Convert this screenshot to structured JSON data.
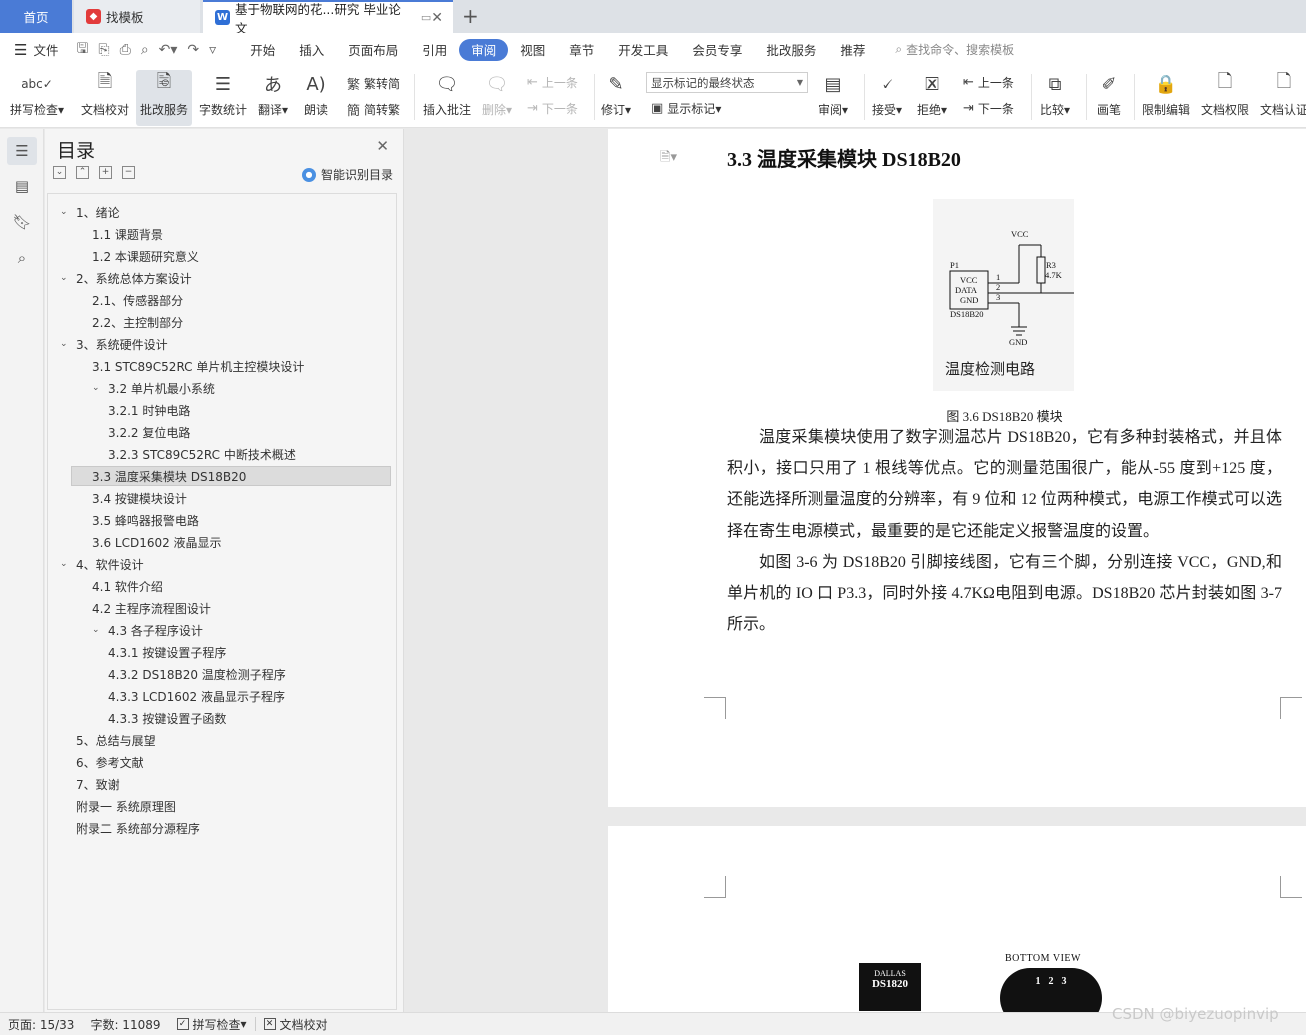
{
  "tabs": {
    "home": "首页",
    "templates": "找模板",
    "document": "基于物联网的花...研究 毕业论文"
  },
  "menubar": {
    "file": "文件",
    "items": [
      "开始",
      "插入",
      "页面布局",
      "引用",
      "审阅",
      "视图",
      "章节",
      "开发工具",
      "会员专享",
      "批改服务",
      "推荐"
    ],
    "active": "审阅",
    "search_placeholder": "查找命令、搜索模板"
  },
  "ribbon": {
    "spell_check": "拼写检查",
    "doc_proof": "文档校对",
    "correction_service": "批改服务",
    "word_count": "字数统计",
    "translate": "翻译",
    "read_aloud": "朗读",
    "simp_to_trad": "繁转简",
    "trad_to_simp": "简转繁",
    "insert_comment": "插入批注",
    "delete": "删除",
    "prev_comment": "上一条",
    "next_comment": "下一条",
    "revise": "修订",
    "markup_state": "显示标记的最终状态",
    "show_markup": "显示标记",
    "review": "审阅",
    "accept": "接受",
    "reject": "拒绝",
    "prev_change": "上一条",
    "next_change": "下一条",
    "compare": "比较",
    "pen": "画笔",
    "restrict_edit": "限制编辑",
    "doc_permission": "文档权限",
    "doc_certify": "文档认证"
  },
  "toc": {
    "title": "目录",
    "smart_recognize": "智能识别目录",
    "items": [
      {
        "label": "1、绪论",
        "level": 1,
        "expanded": true
      },
      {
        "label": "1.1 课题背景",
        "level": 2
      },
      {
        "label": "1.2  本课题研究意义",
        "level": 2
      },
      {
        "label": "2、系统总体方案设计",
        "level": 1,
        "expanded": true
      },
      {
        "label": "2.1、传感器部分",
        "level": 2
      },
      {
        "label": "2.2、主控制部分",
        "level": 2
      },
      {
        "label": "3、系统硬件设计",
        "level": 1,
        "expanded": true
      },
      {
        "label": "3.1 STC89C52RC 单片机主控模块设计",
        "level": 2
      },
      {
        "label": "3.2 单片机最小系统",
        "level": 2,
        "expanded": true
      },
      {
        "label": "3.2.1 时钟电路",
        "level": 3
      },
      {
        "label": "3.2.2 复位电路",
        "level": 3
      },
      {
        "label": "3.2.3 STC89C52RC 中断技术概述",
        "level": 3
      },
      {
        "label": "3.3  温度采集模块 DS18B20",
        "level": 2,
        "selected": true
      },
      {
        "label": "3.4 按键模块设计",
        "level": 2
      },
      {
        "label": "3.5 蜂鸣器报警电路",
        "level": 2
      },
      {
        "label": "3.6 LCD1602 液晶显示",
        "level": 2
      },
      {
        "label": "4、软件设计",
        "level": 1,
        "expanded": true
      },
      {
        "label": "4.1 软件介绍",
        "level": 2
      },
      {
        "label": "4.2  主程序流程图设计",
        "level": 2
      },
      {
        "label": "4.3 各子程序设计",
        "level": 2,
        "expanded": true
      },
      {
        "label": "4.3.1 按键设置子程序",
        "level": 3
      },
      {
        "label": "4.3.2 DS18B20 温度检测子程序",
        "level": 3
      },
      {
        "label": "4.3.3 LCD1602 液晶显示子程序",
        "level": 3
      },
      {
        "label": "4.3.3  按键设置子函数",
        "level": 3
      },
      {
        "label": "5、总结与展望",
        "level": 1
      },
      {
        "label": "6、参考文献",
        "level": 1
      },
      {
        "label": "7、致谢",
        "level": 1
      },
      {
        "label": "附录一  系统原理图",
        "level": 1
      },
      {
        "label": "附录二  系统部分源程序",
        "level": 1
      }
    ]
  },
  "document": {
    "heading": "3.3  温度采集模块 DS18B20",
    "figure": {
      "vcc": "VCC",
      "p1": "P1",
      "r3": "R3",
      "r3_value": "4.7K",
      "pin_vcc": "VCC",
      "pin_data": "DATA",
      "pin_gnd": "GND",
      "pin1": "1",
      "pin2": "2",
      "pin3": "3",
      "chip_name": "DS18B20",
      "gnd": "GND",
      "circuit_title": "温度检测电路"
    },
    "caption": "图 3.6 DS18B20 模块",
    "paragraphs": [
      "温度采集模块使用了数字测温芯片 DS18B20，它有多种封装格式，并且体积小，接口只用了 1 根线等优点。它的测量范围很广，能从-55 度到+125 度，还能选择所测量温度的分辨率，有 9 位和 12 位两种模式，电源工作模式可以选择在寄生电源模式，最重要的是它还能定义报警温度的设置。",
      "如图 3-6 为 DS18B20 引脚接线图，它有三个脚，分别连接 VCC，GND,和单片机的 IO 口 P3.3，同时外接 4.7KΩ电阻到电源。DS18B20 芯片封装如图 3-7 所示。"
    ],
    "page2": {
      "chip_brand": "DALLAS",
      "chip_model": "DS1820",
      "bottom_view": "BOTTOM VIEW",
      "pins": [
        "1",
        "2",
        "3"
      ]
    }
  },
  "statusbar": {
    "page": "页面: 15/33",
    "words": "字数: 11089",
    "spell_check": "拼写检查",
    "doc_proof": "文档校对"
  },
  "watermark": "CSDN @biyezuopinvip"
}
